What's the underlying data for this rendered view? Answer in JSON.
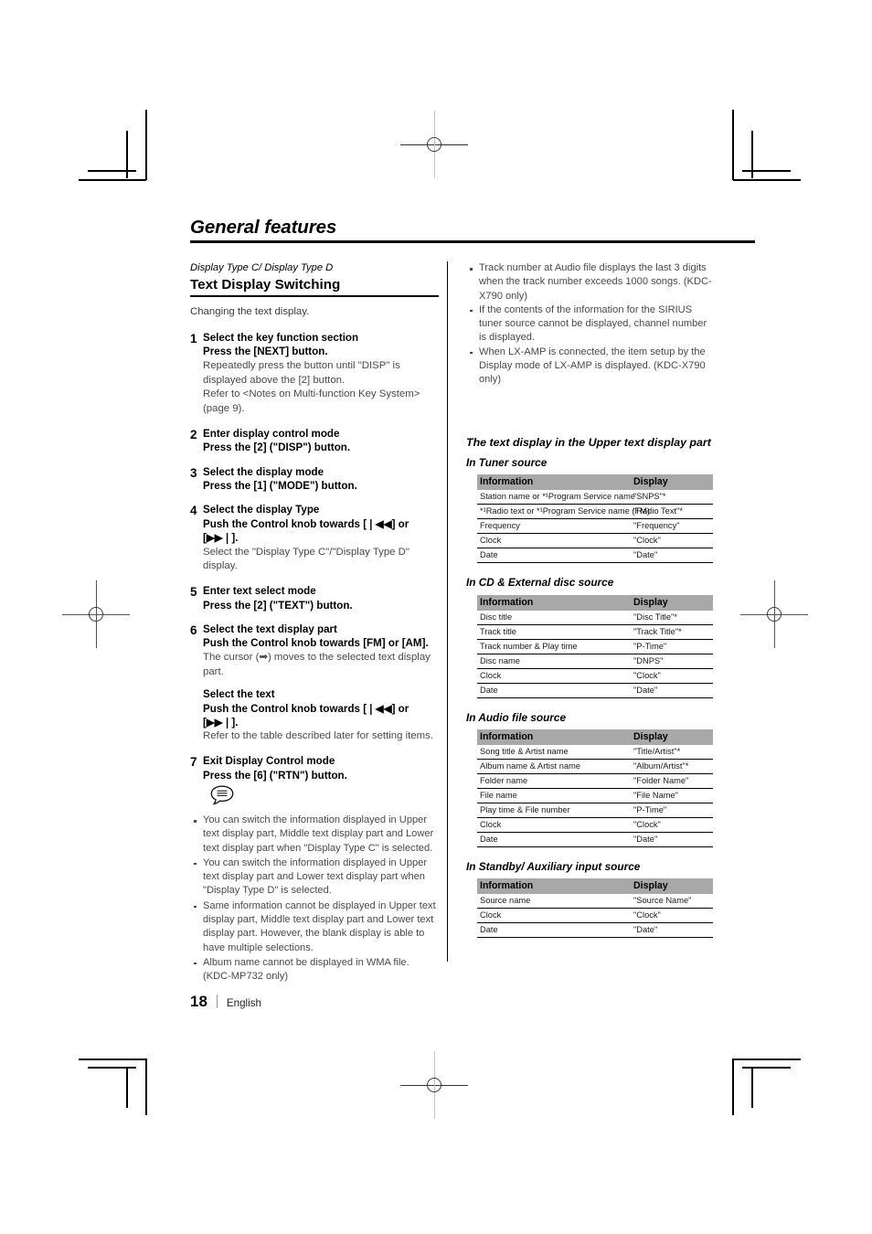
{
  "chapter": {
    "title": "General features"
  },
  "left_column": {
    "kicker": "Display Type C/ Display Type D",
    "section_title": "Text Display Switching",
    "intro": "Changing the text display.",
    "steps": [
      {
        "num": "1",
        "title": "Select the key function section",
        "action": "Press the [NEXT] button.",
        "notes": [
          "Repeatedly press the button until \"DISP\" is displayed above the [2] button.",
          "Refer to <Notes on Multi-function Key System> (page 9)."
        ]
      },
      {
        "num": "2",
        "title": "Enter display control mode",
        "action": "Press the [2] (\"DISP\") button.",
        "notes": []
      },
      {
        "num": "3",
        "title": "Select the display mode",
        "action": "Press the [1] (\"MODE\") button.",
        "notes": []
      },
      {
        "num": "4",
        "title": "Select the display Type",
        "action": "Push the Control knob towards [❘◀◀] or [▶▶❘].",
        "notes": [
          "Select the \"Display Type C\"/\"Display Type D\" display."
        ]
      },
      {
        "num": "5",
        "title": "Enter text select mode",
        "action": "Press the [2] (\"TEXT\") button.",
        "notes": []
      },
      {
        "num": "6",
        "title": "Select the text display part",
        "action": "Push the Control knob towards [FM] or [AM].",
        "notes": [
          "The cursor (➡) moves to the selected text display part."
        ],
        "sub_title": "Select the text",
        "sub_action": "Push the Control knob towards [❘◀◀] or [▶▶❘].",
        "sub_note": "Refer to the table described later for setting items."
      },
      {
        "num": "7",
        "title": "Exit Display Control mode",
        "action": "Press the [6] (\"RTN\") button.",
        "notes": []
      }
    ],
    "note_icon": "speech-bubble-note-icon",
    "notes": [
      "You can switch the information displayed in Upper text display part, Middle text display part and Lower text display part when \"Display Type C\" is selected.",
      "You can switch the information displayed in Upper text display part and Lower text display part when \"Display Type D\" is selected.",
      "Same information cannot be displayed in Upper text display part, Middle text display part and Lower text display part. However, the blank display is able to have multiple selections.",
      "Album name cannot be displayed in WMA file. (KDC-MP732 only)"
    ]
  },
  "right_column": {
    "top_notes": [
      "Track number at Audio file displays the last 3 digits when the track number exceeds 1000 songs. (KDC-X790 only)",
      "If the contents of the information for the SIRIUS tuner source cannot be displayed, channel number is displayed.",
      "When LX-AMP is connected, the item setup by the Display mode of LX-AMP is displayed. (KDC-X790 only)"
    ],
    "heading": "The text display in the Upper text display part",
    "tables": [
      {
        "caption": "In Tuner source",
        "columns": [
          "Information",
          "Display"
        ],
        "rows": [
          [
            "Station name or *¹Program Service name",
            "\"SNPS\"*"
          ],
          [
            "*¹Radio text or *¹Program Service name (FM)",
            "\"Radio Text\"*"
          ],
          [
            "Frequency",
            "\"Frequency\""
          ],
          [
            "Clock",
            "\"Clock\""
          ],
          [
            "Date",
            "\"Date\""
          ]
        ]
      },
      {
        "caption": "In CD & External disc source",
        "columns": [
          "Information",
          "Display"
        ],
        "rows": [
          [
            "Disc title",
            "\"Disc Title\"*"
          ],
          [
            "Track title",
            "\"Track Title\"*"
          ],
          [
            "Track number & Play time",
            "\"P-Time\""
          ],
          [
            "Disc name",
            "\"DNPS\""
          ],
          [
            "Clock",
            "\"Clock\""
          ],
          [
            "Date",
            "\"Date\""
          ]
        ]
      },
      {
        "caption": "In Audio file source",
        "columns": [
          "Information",
          "Display"
        ],
        "rows": [
          [
            "Song title & Artist name",
            "\"Title/Artist\"*"
          ],
          [
            "Album name & Artist name",
            "\"Album/Artist\"*"
          ],
          [
            "Folder name",
            "\"Folder Name\""
          ],
          [
            "File name",
            "\"File Name\""
          ],
          [
            "Play time & File number",
            "\"P-Time\""
          ],
          [
            "Clock",
            "\"Clock\""
          ],
          [
            "Date",
            "\"Date\""
          ]
        ]
      },
      {
        "caption": "In Standby/ Auxiliary input source",
        "columns": [
          "Information",
          "Display"
        ],
        "rows": [
          [
            "Source name",
            "\"Source Name\""
          ],
          [
            "Clock",
            "\"Clock\""
          ],
          [
            "Date",
            "\"Date\""
          ]
        ]
      }
    ]
  },
  "footer": {
    "page_number": "18",
    "language": "English"
  },
  "colors": {
    "table_header_bg": "#a8a8a8",
    "rule": "#000000",
    "body_text": "#4a4a4a"
  }
}
